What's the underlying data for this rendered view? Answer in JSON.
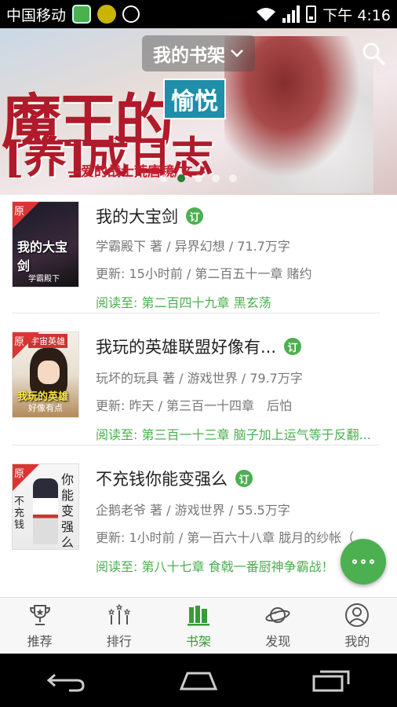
{
  "status_bar": {
    "carrier": "中国移动",
    "time": "下午 4:16"
  },
  "header": {
    "title": "我的书架",
    "icons": {
      "dropdown": "chevron-down-icon",
      "search": "search-icon"
    }
  },
  "banner": {
    "title_line1": "魔王的",
    "title_line2": "[养]成日志",
    "tag": "愉悦",
    "subtitle": "—爱的战士荒唐镜/文—",
    "dots": 5,
    "active_dot": 1
  },
  "books": [
    {
      "title": "我的大宝剑",
      "badge": "订",
      "author_line": "学霸殿下 著 / 异界幻想 / 71.7万字",
      "update_line": "更新: 15小时前 / 第二百五十一章 赌约",
      "progress_line": "阅读至: 第二百四十九章 黑玄荡",
      "cover": {
        "ribbon": "原",
        "title": "我的大宝剑",
        "sub": "学霸殿下"
      }
    },
    {
      "title": "我玩的英雄联盟好像有...",
      "badge": "订",
      "author_line": "玩坏的玩具 著 / 游戏世界 / 79.7万字",
      "update_line": "更新: 昨天 / 第三百一十四章　后怕",
      "progress_line": "阅读至: 第三百一十三章 脑子加上运气等于反翻...",
      "cover": {
        "ribbon": "原",
        "top_label": "宇宙英雄",
        "title": "我玩的英雄",
        "sub": "好像有点"
      }
    },
    {
      "title": "不充钱你能变强么",
      "badge": "订",
      "author_line": "企鹅老爷 著 / 游戏世界 / 55.5万字",
      "update_line": "更新: 1小时前 / 第一百六十八章 胧月的纱帐（",
      "progress_line": "阅读至: 第八十七章 食戟一番厨神争霸战！",
      "cover": {
        "ribbon": "原",
        "side_text": "你能变强么",
        "left_text": "不充钱"
      }
    }
  ],
  "fab": {
    "icon": "more-dots-icon"
  },
  "bottom_nav": [
    {
      "label": "推荐",
      "icon": "trophy-icon",
      "active": false
    },
    {
      "label": "排行",
      "icon": "ranking-icon",
      "active": false
    },
    {
      "label": "书架",
      "icon": "bookshelf-icon",
      "active": true
    },
    {
      "label": "发现",
      "icon": "planet-icon",
      "active": false
    },
    {
      "label": "我的",
      "icon": "user-icon",
      "active": false
    }
  ],
  "colors": {
    "accent": "#4caf50",
    "nav_active": "#3a9a3a",
    "ribbon": "#d33333"
  }
}
